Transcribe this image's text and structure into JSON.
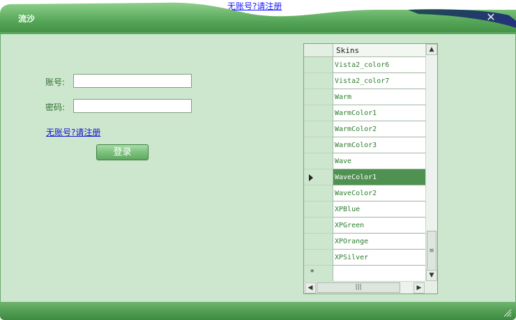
{
  "background_window": {
    "link_text": "无账号?请注册"
  },
  "window": {
    "title": "流沙",
    "close_glyph": "✕"
  },
  "form": {
    "account_label": "账号:",
    "account_value": "",
    "password_label": "密码:",
    "password_value": "",
    "register_link": "无账号?请注册",
    "login_button": "登录"
  },
  "grid": {
    "column_header": "Skins",
    "rows": [
      "Vista2_color6",
      "Vista2_color7",
      "Warm",
      "WarmColor1",
      "WarmColor2",
      "WarmColor3",
      "Wave",
      "WaveColor1",
      "WaveColor2",
      "XPBlue",
      "XPGreen",
      "XPOrange",
      "XPSilver",
      ""
    ],
    "selected_index": 7,
    "new_row_marker": "*",
    "scroll_glyphs": {
      "up": "▲",
      "down": "▼",
      "left": "◀",
      "right": "▶",
      "thumb_v": "≡",
      "thumb_h": "|||"
    }
  },
  "colors": {
    "accent": "#4f9150",
    "client_bg": "#cde7ce",
    "title_dark": "#1f5a28",
    "link": "#1010cc"
  }
}
